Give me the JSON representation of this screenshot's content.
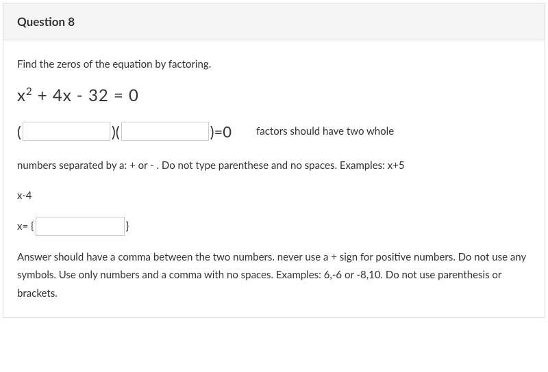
{
  "header": {
    "title": "Question 8"
  },
  "body": {
    "prompt": "Find the zeros of the equation by factoring.",
    "equation_prefix": "x",
    "equation_exp": "2",
    "equation_rest": " + 4x - 32  = 0",
    "factors": {
      "open1": "(",
      "close1": ")(",
      "close2": ")=0",
      "hint": "factors should have two whole"
    },
    "hint_block": "numbers separated by a: + or - .  Do not type parenthese and no spaces.  Examples:  x+5",
    "xminus": "x-4",
    "solution": {
      "label": "x= {",
      "close": "}"
    },
    "final_instructions": "  Answer should have a comma between the two numbers.  never use a + sign for positive numbers.  Do not use any symbols.  Use only numbers and a comma with no spaces.  Examples:      6,-6   or    -8,10.  Do not use parenthesis or brackets."
  }
}
